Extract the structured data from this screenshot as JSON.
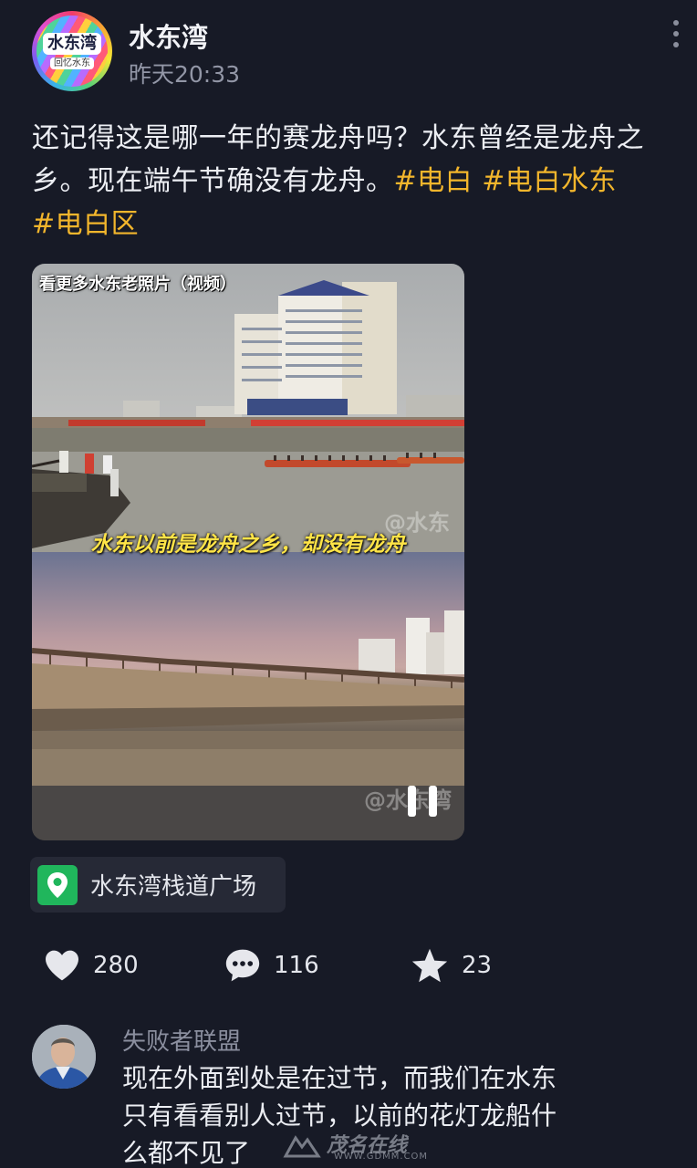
{
  "post": {
    "author": {
      "name": "水东湾",
      "avatar_text": "水东湾",
      "avatar_subtext": "回忆水东"
    },
    "time": "昨天20:33",
    "text": "还记得这是哪一年的赛龙舟吗？水东曾经是龙舟之乡。现在端午节确没有龙舟。",
    "hashtags": [
      "#电白",
      "#电白水东",
      "#电白区"
    ],
    "video": {
      "overlay_title": "看更多水东老照片（视频）",
      "caption": "水东以前是龙舟之乡，却没有龙舟",
      "watermark": "@水东湾",
      "state": "playing"
    },
    "location": "水东湾栈道广场",
    "stats": {
      "likes": "280",
      "comments": "116",
      "favorites": "23"
    }
  },
  "comment": {
    "author": "失败者联盟",
    "text": "现在外面到处是在过节，而我们在水东只有看看别人过节，以前的花灯龙船什么都不见了"
  },
  "site_watermark": {
    "name": "茂名在线",
    "url": "WWW.GDMM.COM"
  },
  "colors": {
    "background": "#171a26",
    "hashtag": "#f3b62c",
    "location_green": "#20b65c",
    "caption_yellow": "#ffe447"
  }
}
